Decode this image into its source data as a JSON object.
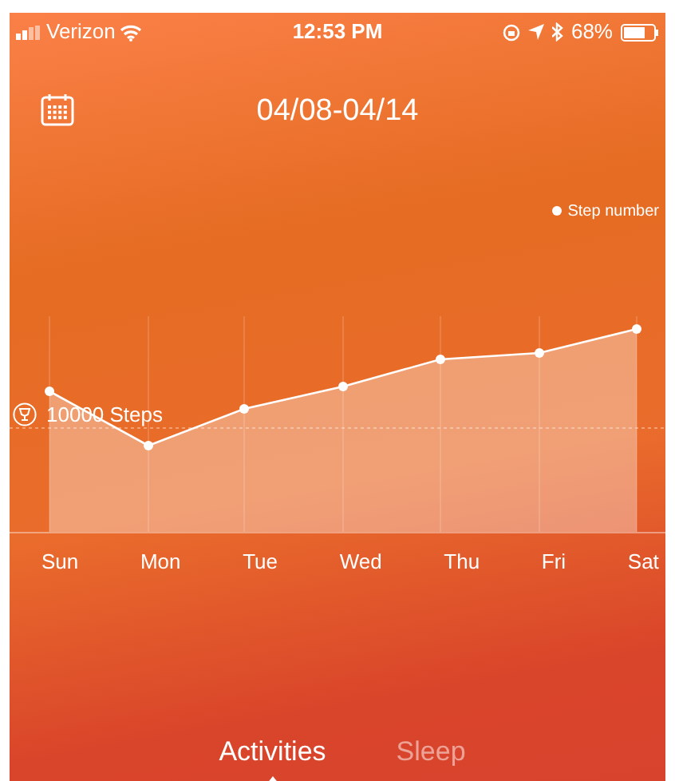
{
  "status_bar": {
    "carrier": "Verizon",
    "time": "12:53 PM",
    "battery": "68%"
  },
  "header": {
    "title": "04/08-04/14"
  },
  "chart": {
    "legend": "Step number",
    "goal": "10000 Steps",
    "days": [
      "Sun",
      "Mon",
      "Tue",
      "Wed",
      "Thu",
      "Fri",
      "Sat"
    ]
  },
  "tabs": [
    {
      "label": "Activities",
      "selected": true
    },
    {
      "label": "Sleep",
      "selected": false
    }
  ]
}
